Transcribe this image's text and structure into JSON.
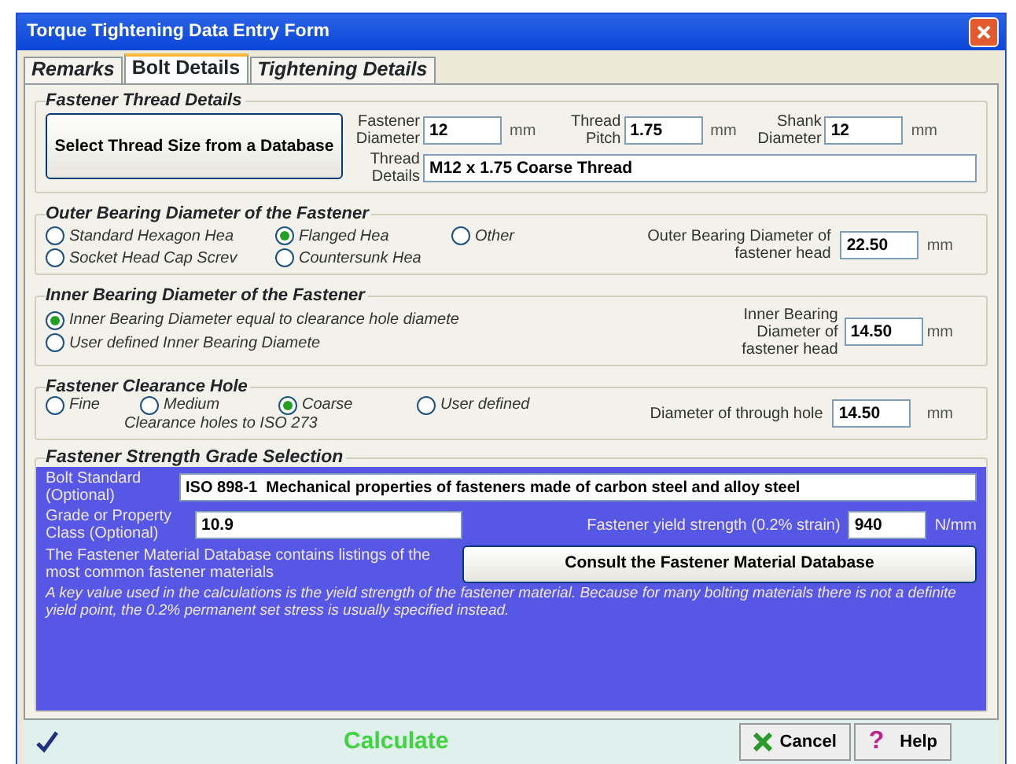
{
  "window": {
    "title": "Torque Tightening Data Entry Form"
  },
  "tabs": [
    {
      "label": "Remarks",
      "selected": false
    },
    {
      "label": "Bolt Details",
      "selected": true
    },
    {
      "label": "Tightening Details",
      "selected": false
    }
  ],
  "thread_details": {
    "title": "Fastener Thread Details",
    "button": "Select Thread Size from a Database",
    "fields": [
      {
        "label": "Fastener Diameter",
        "value": "12",
        "unit": "mm"
      },
      {
        "label": "Thread Pitch",
        "value": "1.75",
        "unit": "mm"
      },
      {
        "label": "Shank Diameter",
        "value": "12",
        "unit": "mm"
      }
    ],
    "details": {
      "label": "Thread Details",
      "value": "M12 x 1.75 Coarse Thread"
    }
  },
  "outer_bearing": {
    "title": "Outer Bearing Diameter of the Fastener",
    "options": [
      {
        "label": "Standard Hexagon Hea",
        "selected": false
      },
      {
        "label": "Flanged Hea",
        "selected": true
      },
      {
        "label": "Other",
        "selected": false
      },
      {
        "label": "Socket Head Cap Screv",
        "selected": false
      },
      {
        "label": "Countersunk Hea",
        "selected": false
      }
    ],
    "field": {
      "label": "Outer Bearing Diameter of fastener head",
      "value": "22.50",
      "unit": "mm"
    }
  },
  "inner_bearing": {
    "title": "Inner Bearing Diameter of the Fastener",
    "options": [
      {
        "label": "Inner Bearing Diameter equal to clearance hole diamete",
        "selected": true
      },
      {
        "label": "User defined Inner Bearing Diamete",
        "selected": false
      }
    ],
    "field": {
      "label": "Inner Bearing Diameter of fastener head",
      "value": "14.50",
      "unit": "mm"
    }
  },
  "clearance_hole": {
    "title": "Fastener Clearance Hole",
    "options": [
      {
        "label": "Fine",
        "selected": false
      },
      {
        "label": "Medium",
        "selected": false
      },
      {
        "label": "Coarse",
        "selected": true
      },
      {
        "label": "User defined",
        "selected": false
      }
    ],
    "note": "Clearance holes to ISO 273",
    "field": {
      "label": "Diameter of through hole",
      "value": "14.50",
      "unit": "mm"
    }
  },
  "strength_grade": {
    "title": "Fastener Strength Grade Selection",
    "standard": {
      "label": "Bolt Standard (Optional)",
      "value": "ISO 898-1  Mechanical properties of fasteners made of carbon steel and alloy steel"
    },
    "grade": {
      "label": "Grade or Property Class (Optional)",
      "value": "10.9"
    },
    "yield": {
      "label": "Fastener yield strength (0.2% strain)",
      "value": "940",
      "unit": "N/mm"
    },
    "database_note": "The Fastener Material Database contains listings of the most common fastener materials",
    "database_button": "Consult the Fastener Material Database",
    "footnote": "A key value used in the calculations is the yield strength of the fastener material. Because for many bolting materials there is not a definite yield point, the 0.2% permanent set stress is usually specified instead."
  },
  "actions": [
    {
      "kind": "calculate",
      "label": "Calculate"
    },
    {
      "kind": "cancel",
      "label": "Cancel"
    },
    {
      "kind": "help",
      "icon": "?",
      "label": "Help"
    }
  ]
}
